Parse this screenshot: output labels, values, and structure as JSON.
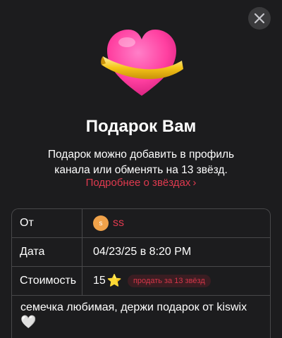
{
  "close_button": {
    "icon": "close-icon"
  },
  "gift": {
    "icon": "heart-with-ribbon-icon",
    "colors": {
      "heart": "#ff3fa0",
      "ribbon": "#f5c518"
    }
  },
  "title": "Подарок Вам",
  "description": {
    "line1": "Подарок можно добавить в профиль",
    "line2": "канала или обменять на 13 звёзд."
  },
  "more_link": {
    "label": "Подробнее о звёздах",
    "chevron": "›"
  },
  "table": {
    "from": {
      "label": "От",
      "avatar_letter": "s",
      "name": "ss"
    },
    "date": {
      "label": "Дата",
      "value": "04/23/25 в 8:20 PM"
    },
    "cost": {
      "label": "Стоимость",
      "value": "15",
      "star": "⭐",
      "sell_label": "продать за 13 звёзд"
    },
    "message": {
      "text": "семечка любимая, держи подарок от kiswix",
      "emoji": "🤍"
    }
  },
  "colors": {
    "background": "#1c1c1e",
    "accent": "#e03a4f",
    "border": "#48484a"
  }
}
